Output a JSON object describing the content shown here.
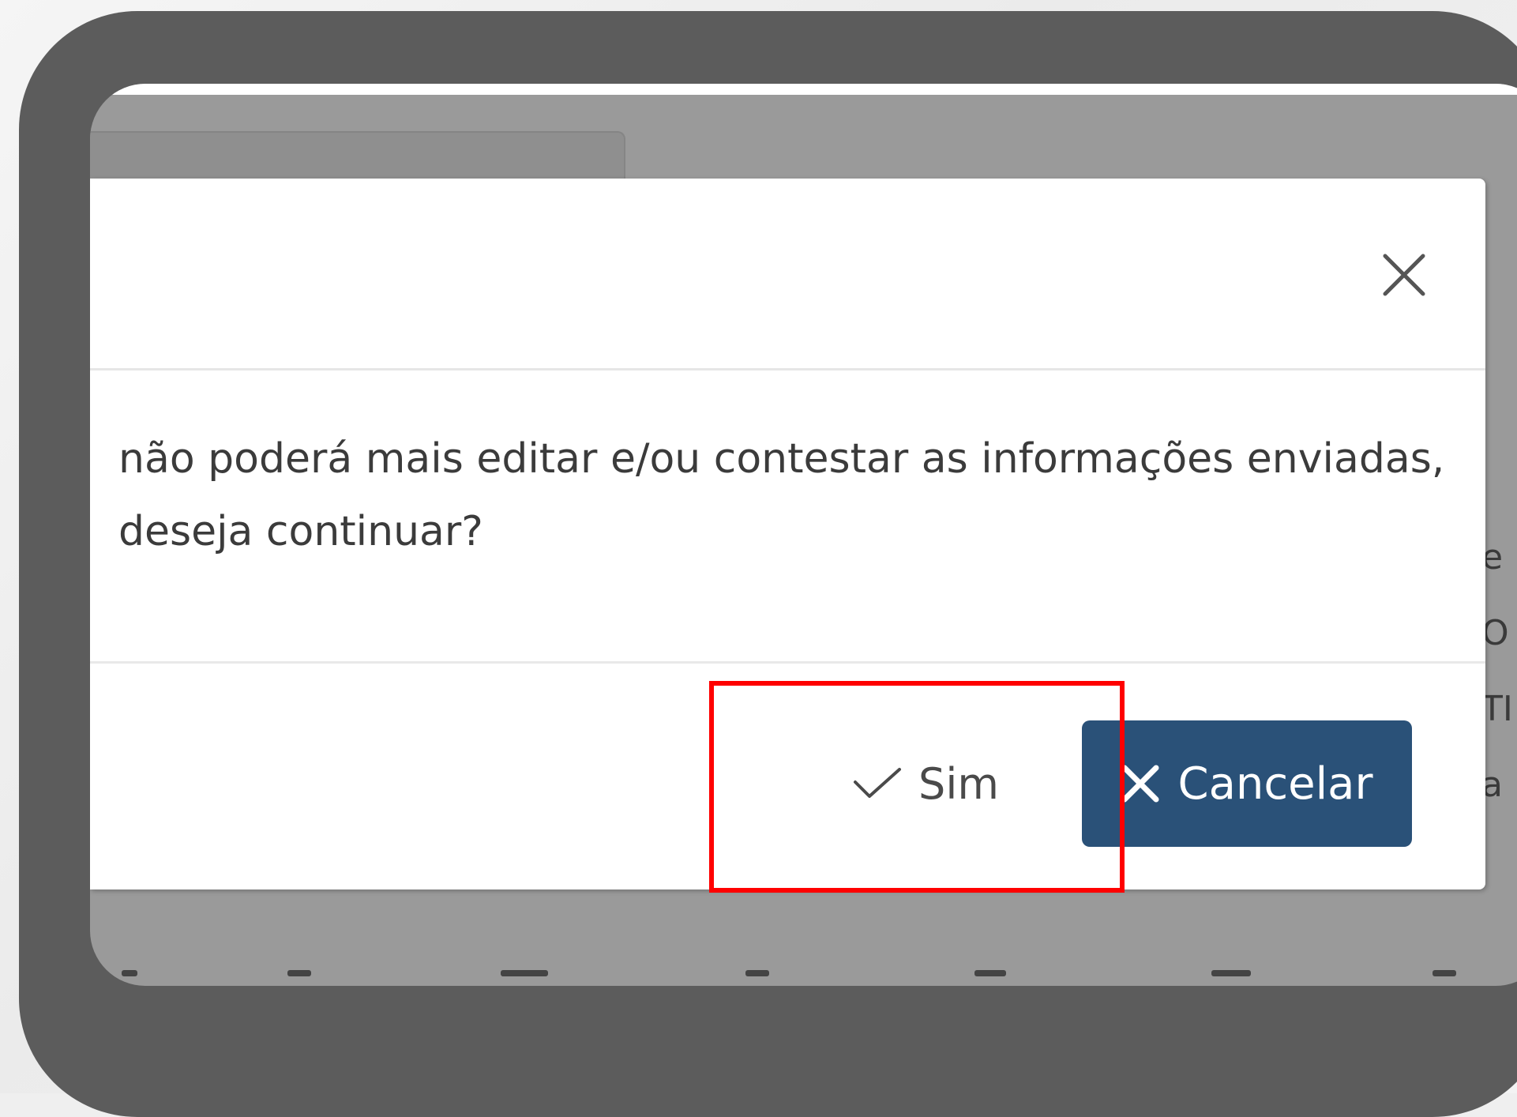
{
  "dialog": {
    "message": "não poderá mais editar e/ou contestar as informações enviadas,\ndeseja continuar?",
    "close_icon": "close-icon",
    "buttons": {
      "confirm_label": "Sim",
      "confirm_icon": "check-icon",
      "cancel_label": "Cancelar",
      "cancel_icon": "x-icon"
    }
  },
  "background": {
    "side_text_lines": [
      "e",
      "O",
      "TI",
      "a"
    ]
  },
  "colors": {
    "frame": "#5c5c5c",
    "overlay": "#9a9a9a",
    "cancel_button_bg": "#2a5178",
    "highlight_border": "#ff0000"
  }
}
